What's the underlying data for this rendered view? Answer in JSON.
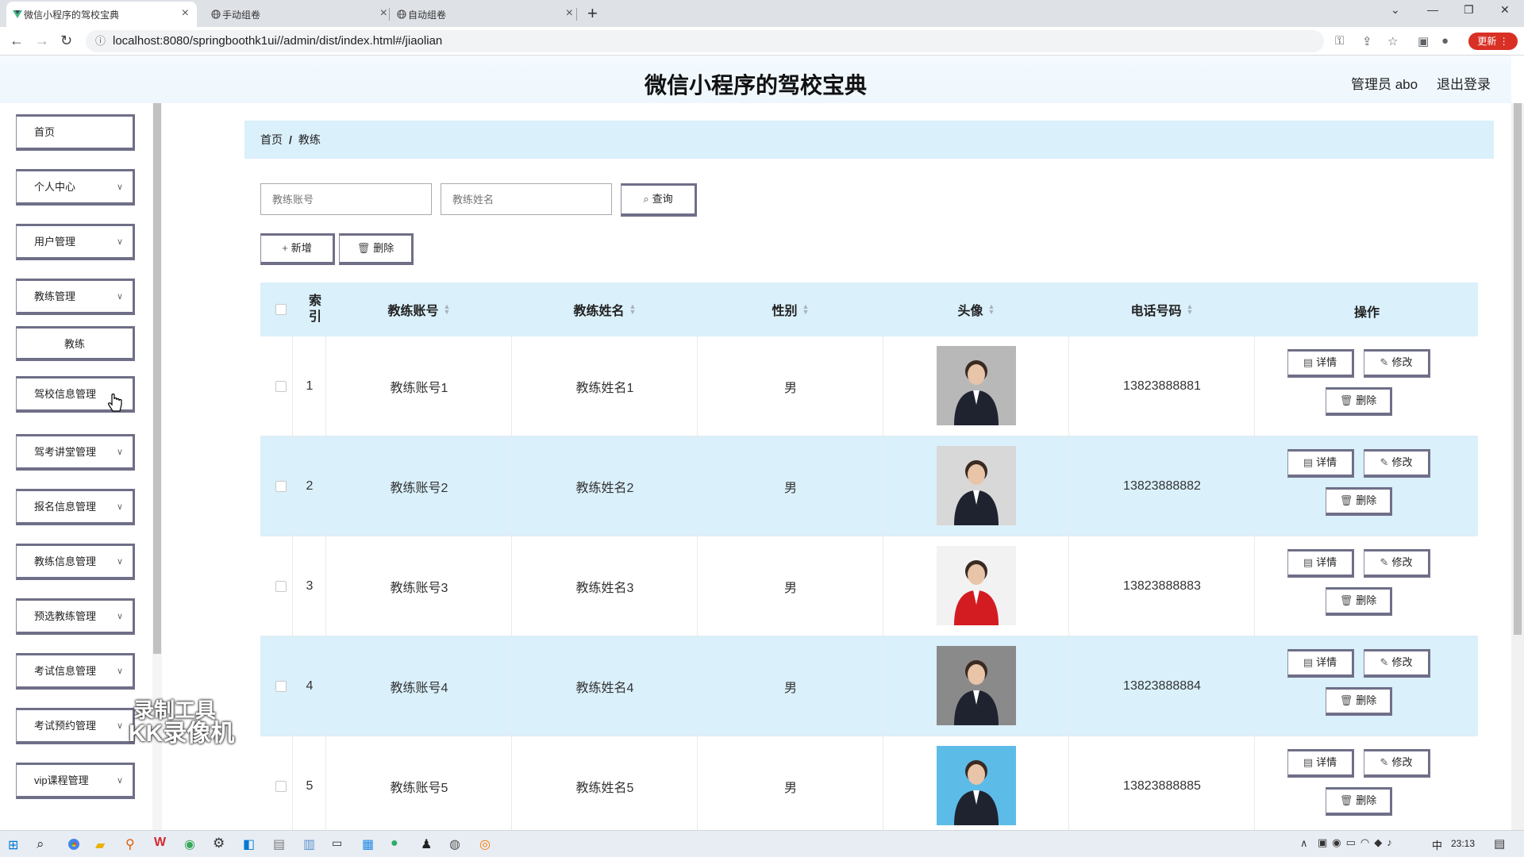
{
  "browser": {
    "tabs": [
      {
        "title": "微信小程序的驾校宝典",
        "active": true
      },
      {
        "title": "手动组卷",
        "active": false
      },
      {
        "title": "自动组卷",
        "active": false
      }
    ],
    "url": "localhost:8080/springboothk1ui//admin/dist/index.html#/jiaolian",
    "update_label": "更新"
  },
  "header": {
    "title": "微信小程序的驾校宝典",
    "admin": "管理员 abo",
    "logout": "退出登录"
  },
  "sidebar": {
    "items": [
      {
        "label": "首页",
        "has_children": false
      },
      {
        "label": "个人中心",
        "has_children": true
      },
      {
        "label": "用户管理",
        "has_children": true
      },
      {
        "label": "教练管理",
        "has_children": true
      },
      {
        "label": "教练",
        "has_children": false,
        "sub": true
      },
      {
        "label": "驾校信息管理",
        "has_children": true
      },
      {
        "label": "驾考讲堂管理",
        "has_children": true
      },
      {
        "label": "报名信息管理",
        "has_children": true
      },
      {
        "label": "教练信息管理",
        "has_children": true
      },
      {
        "label": "预选教练管理",
        "has_children": true
      },
      {
        "label": "考试信息管理",
        "has_children": true
      },
      {
        "label": "考试预约管理",
        "has_children": true
      },
      {
        "label": "vip课程管理",
        "has_children": true
      }
    ]
  },
  "watermark": {
    "line1": "录制工具",
    "line2": "KK录像机"
  },
  "breadcrumb": {
    "home": "首页",
    "separator": "/",
    "current": "教练"
  },
  "search": {
    "account_placeholder": "教练账号",
    "name_placeholder": "教练姓名",
    "query_label": "查询"
  },
  "toolbar": {
    "add_label": "新增",
    "delete_label": "删除"
  },
  "table": {
    "columns": [
      "索引",
      "教练账号",
      "教练姓名",
      "性别",
      "头像",
      "电话号码",
      "操作"
    ],
    "actions": {
      "detail": "详情",
      "edit": "修改",
      "delete": "删除"
    },
    "rows": [
      {
        "index": "1",
        "account": "教练账号1",
        "name": "教练姓名1",
        "gender": "男",
        "phone": "13823888881",
        "avatar_bg": "#b8b8b8"
      },
      {
        "index": "2",
        "account": "教练账号2",
        "name": "教练姓名2",
        "gender": "男",
        "phone": "13823888882",
        "avatar_bg": "#d8d8d8"
      },
      {
        "index": "3",
        "account": "教练账号3",
        "name": "教练姓名3",
        "gender": "男",
        "phone": "13823888883",
        "avatar_bg": "#f2f2f2"
      },
      {
        "index": "4",
        "account": "教练账号4",
        "name": "教练姓名4",
        "gender": "男",
        "phone": "13823888884",
        "avatar_bg": "#8a8a8a"
      },
      {
        "index": "5",
        "account": "教练账号5",
        "name": "教练姓名5",
        "gender": "男",
        "phone": "13823888885",
        "avatar_bg": "#5dbbe8"
      }
    ]
  },
  "taskbar": {
    "time": "23:13",
    "ime": "中"
  }
}
